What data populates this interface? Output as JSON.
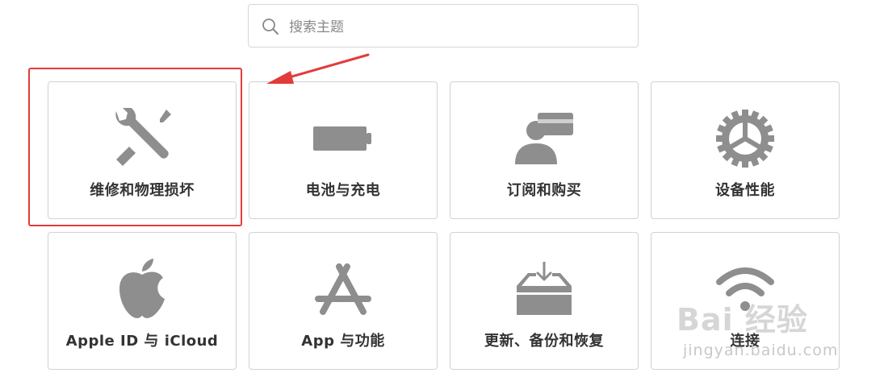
{
  "search": {
    "placeholder": "搜索主题"
  },
  "tiles": [
    {
      "label": "维修和物理损坏",
      "icon": "wrench-screwdriver-icon"
    },
    {
      "label": "电池与充电",
      "icon": "battery-icon"
    },
    {
      "label": "订阅和购买",
      "icon": "person-card-icon"
    },
    {
      "label": "设备性能",
      "icon": "gear-icon"
    },
    {
      "label": "Apple ID 与 iCloud",
      "icon": "apple-logo-icon"
    },
    {
      "label": "App 与功能",
      "icon": "app-store-icon"
    },
    {
      "label": "更新、备份和恢复",
      "icon": "download-tray-icon"
    },
    {
      "label": "连接",
      "icon": "wifi-icon"
    }
  ],
  "watermark": {
    "brand": "Bai 经验",
    "url": "jingyan.baidu.com"
  },
  "colors": {
    "icon": "#8e8e8e",
    "highlight": "#e23b3b",
    "border": "#d2d2d7"
  }
}
